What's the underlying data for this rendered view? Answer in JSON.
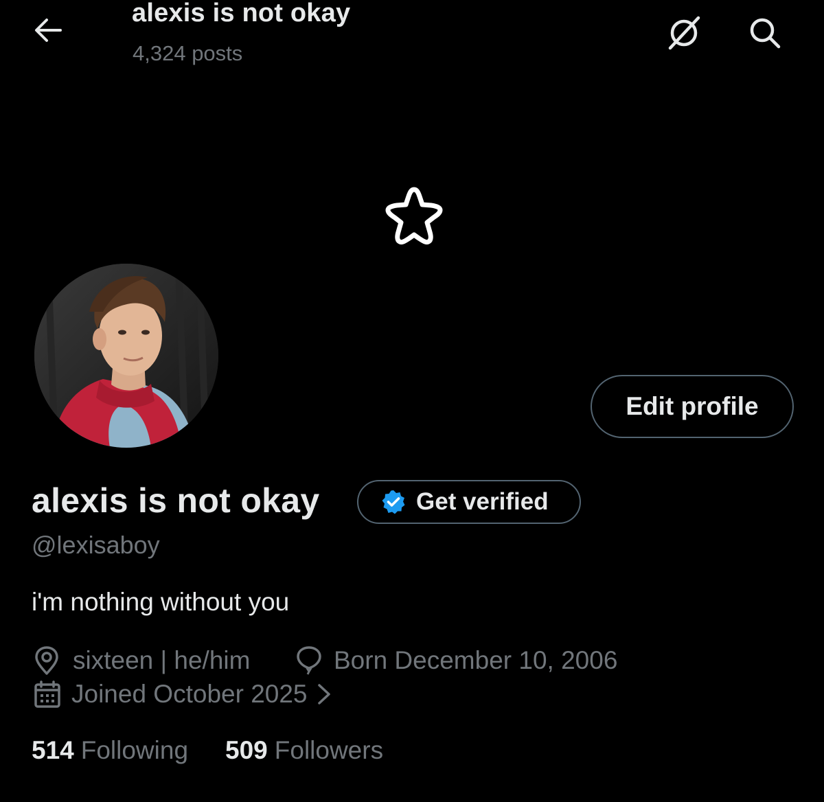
{
  "header": {
    "title": "alexis is not okay",
    "post_count": "4,324 posts"
  },
  "icons": {
    "back": "arrow-left-icon",
    "grok": "grok-icon",
    "search": "search-icon",
    "banner": "star-outline-icon",
    "verified": "verified-badge-icon",
    "location": "location-pin-icon",
    "birthday": "balloon-icon",
    "calendar": "calendar-icon",
    "chevron": "chevron-right-icon"
  },
  "profile": {
    "display_name": "alexis is not okay",
    "handle": "@lexisaboy",
    "bio": "i'm nothing without you",
    "location": "sixteen | he/him",
    "birthday": "Born December 10, 2006",
    "joined": "Joined October 2025",
    "edit_label": "Edit profile",
    "verify_label": "Get verified"
  },
  "stats": {
    "following_count": "514",
    "following_label": "Following",
    "followers_count": "509",
    "followers_label": "Followers"
  },
  "colors": {
    "background": "#000000",
    "primary_text": "#e7e9ea",
    "secondary_text": "#71767b",
    "border": "#536471",
    "verified_blue": "#1d9bf0"
  }
}
